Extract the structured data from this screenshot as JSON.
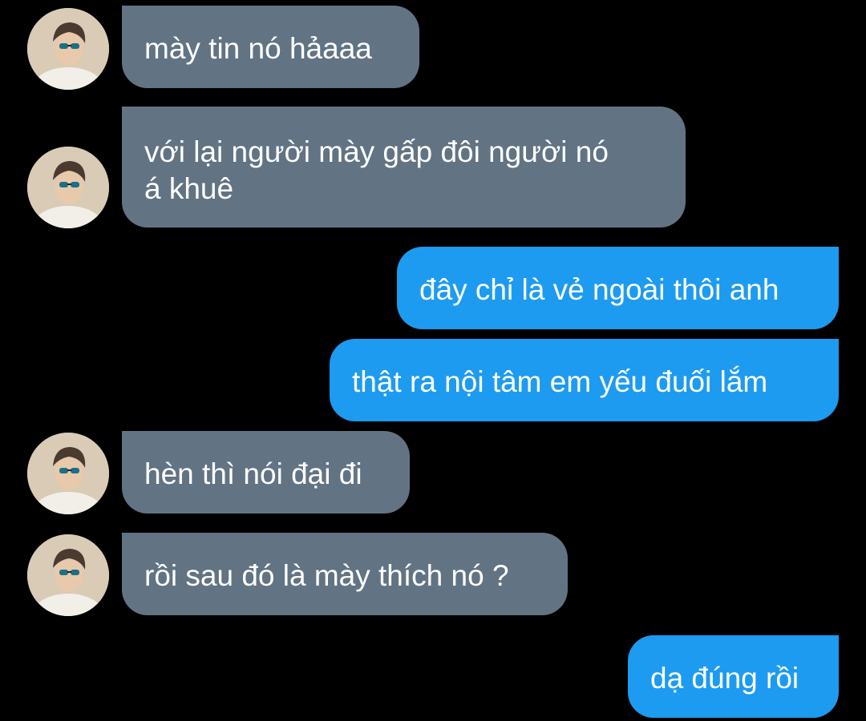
{
  "messages": [
    {
      "from": "them",
      "text": "mày tin nó hảaaa"
    },
    {
      "from": "them",
      "lines": [
        "với lại người mày gấp đôi người nó",
        "á khuê"
      ]
    },
    {
      "from": "me",
      "text": "đây chỉ là vẻ ngoài thôi anh"
    },
    {
      "from": "me",
      "text": "thật ra nội tâm em yếu đuối lắm"
    },
    {
      "from": "them",
      "text": "hèn thì nói đại đi"
    },
    {
      "from": "them",
      "text": "rồi sau đó là mày thích nó ?"
    },
    {
      "from": "me",
      "text": "dạ đúng rồi"
    }
  ],
  "colors": {
    "background": "#000000",
    "incoming_bubble": "#627384",
    "outgoing_bubble": "#1d9bf0",
    "text": "#ffffff"
  },
  "icons": {
    "avatar": "user-avatar-photo"
  }
}
